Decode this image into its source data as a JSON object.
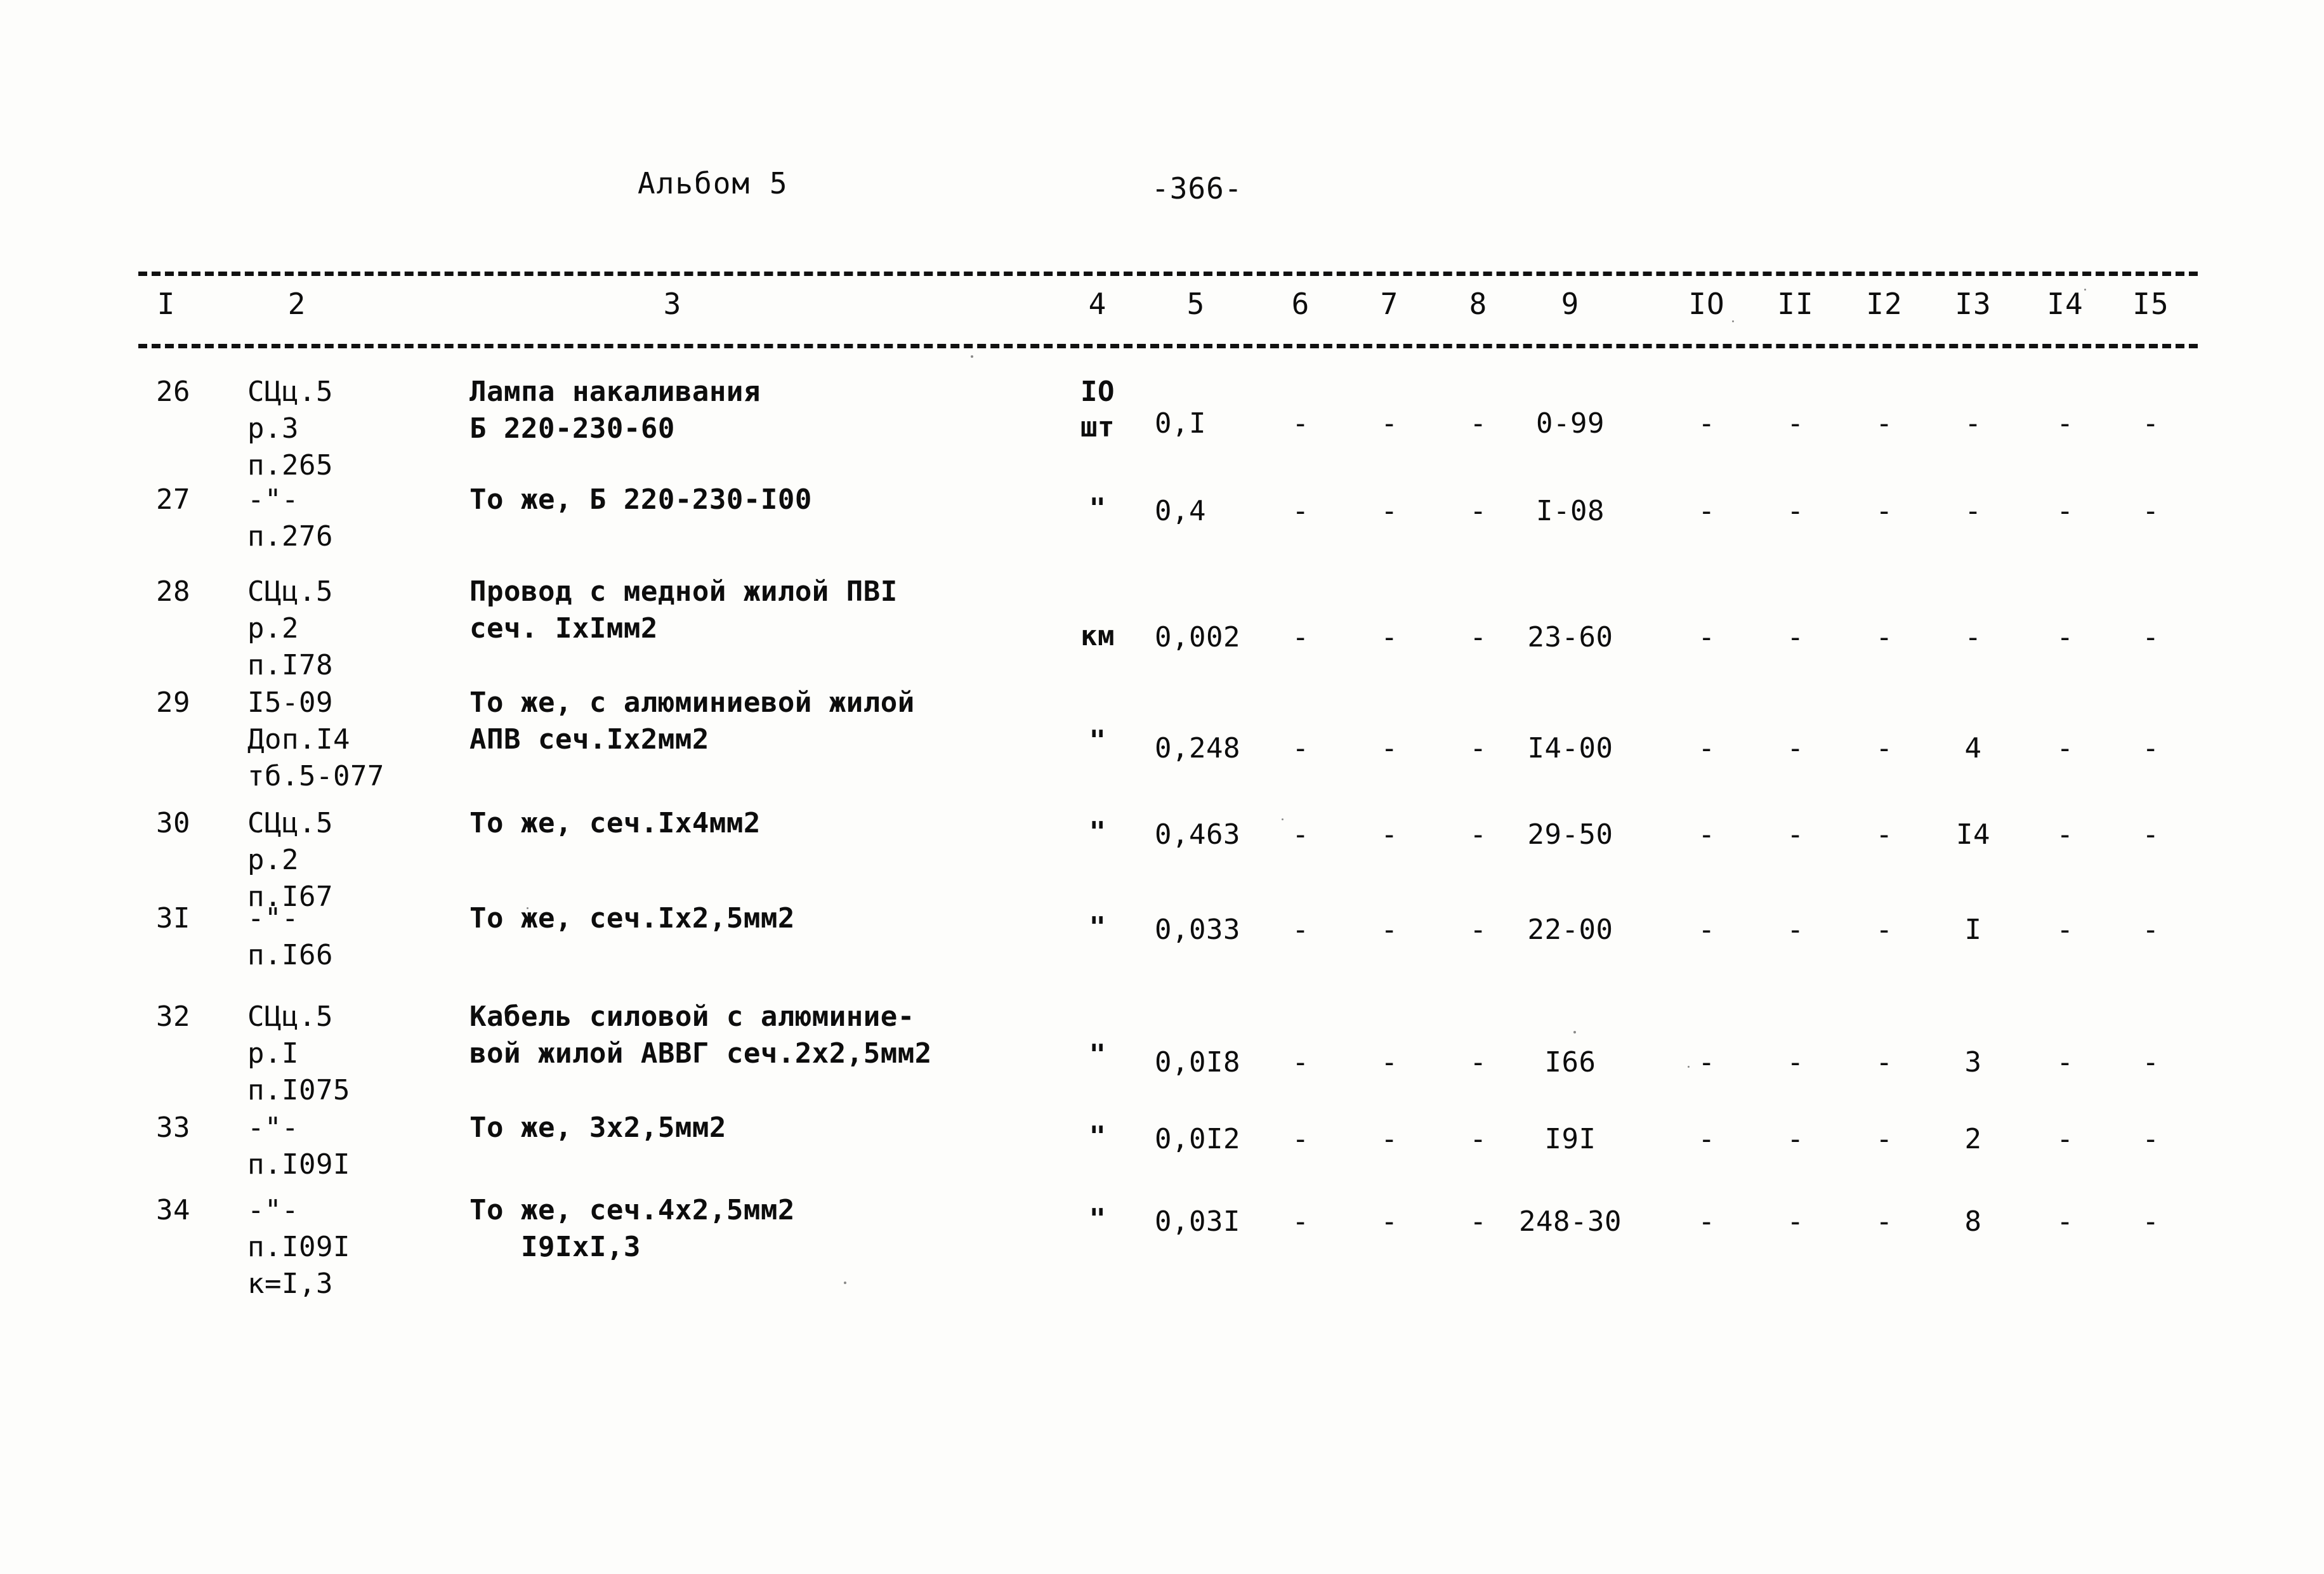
{
  "header": {
    "album_title": "Альбом 5",
    "page_number": "-366-"
  },
  "table": {
    "column_headers": [
      "I",
      "2",
      "3",
      "4",
      "5",
      "6",
      "7",
      "8",
      "9",
      "IO",
      "II",
      "I2",
      "I3",
      "I4",
      "I5"
    ],
    "rows": [
      {
        "no": "26",
        "ref_lines": [
          "СЦц.5",
          "р.3",
          "п.265"
        ],
        "desc_lines": [
          "Лампа накаливания",
          "Б 220-230-60"
        ],
        "unit_lines": [
          "IO",
          "шт"
        ],
        "qty": "0,I",
        "c6": "-",
        "c7": "-",
        "c8": "-",
        "c9": "0-99",
        "c10": "-",
        "c11": "-",
        "c12": "-",
        "c13": "-",
        "c14": "-",
        "c15": "-"
      },
      {
        "no": "27",
        "ref_lines": [
          "-\"-",
          "п.276"
        ],
        "desc_lines": [
          "То же, Б 220-230-I00"
        ],
        "unit_lines": [
          "\""
        ],
        "qty": "0,4",
        "c6": "-",
        "c7": "-",
        "c8": "-",
        "c9": "I-08",
        "c10": "-",
        "c11": "-",
        "c12": "-",
        "c13": "-",
        "c14": "-",
        "c15": "-"
      },
      {
        "no": "28",
        "ref_lines": [
          "СЦц.5",
          "р.2",
          "п.I78"
        ],
        "desc_lines": [
          "Провод с медной жилой ПВI",
          "сеч. IxIмм2"
        ],
        "unit_lines": [
          "км"
        ],
        "qty": "0,002",
        "c6": "-",
        "c7": "-",
        "c8": "-",
        "c9": "23-60",
        "c10": "-",
        "c11": "-",
        "c12": "-",
        "c13": "-",
        "c14": "-",
        "c15": "-"
      },
      {
        "no": "29",
        "ref_lines": [
          "I5-09",
          "Доп.I4",
          "тб.5-077"
        ],
        "desc_lines": [
          "То же, с алюминиевой жилой",
          "АПВ сеч.Ix2мм2"
        ],
        "unit_lines": [
          "\""
        ],
        "qty": "0,248",
        "c6": "-",
        "c7": "-",
        "c8": "-",
        "c9": "I4-00",
        "c10": "-",
        "c11": "-",
        "c12": "-",
        "c13": "4",
        "c14": "-",
        "c15": "-"
      },
      {
        "no": "30",
        "ref_lines": [
          "СЦц.5",
          "р.2",
          "п.I67"
        ],
        "desc_lines": [
          "То же, сеч.Ix4мм2"
        ],
        "unit_lines": [
          "\""
        ],
        "qty": "0,463",
        "c6": "-",
        "c7": "-",
        "c8": "-",
        "c9": "29-50",
        "c10": "-",
        "c11": "-",
        "c12": "-",
        "c13": "I4",
        "c14": "-",
        "c15": "-"
      },
      {
        "no": "3I",
        "ref_lines": [
          "-\"-",
          "п.I66"
        ],
        "desc_lines": [
          "То же, сеч.Ix2,5мм2"
        ],
        "unit_lines": [
          "\""
        ],
        "qty": "0,033",
        "c6": "-",
        "c7": "-",
        "c8": "-",
        "c9": "22-00",
        "c10": "-",
        "c11": "-",
        "c12": "-",
        "c13": "I",
        "c14": "-",
        "c15": "-"
      },
      {
        "no": "32",
        "ref_lines": [
          "СЦц.5",
          "р.I",
          "п.I075"
        ],
        "desc_lines": [
          "Кабель силовой с алюминие-",
          "вой жилой АВВГ сеч.2x2,5мм2"
        ],
        "unit_lines": [
          "\""
        ],
        "qty": "0,0I8",
        "c6": "-",
        "c7": "-",
        "c8": "-",
        "c9": "I66",
        "c10": "-",
        "c11": "-",
        "c12": "-",
        "c13": "3",
        "c14": "-",
        "c15": "-"
      },
      {
        "no": "33",
        "ref_lines": [
          "-\"-",
          "п.I09I"
        ],
        "desc_lines": [
          "То же, 3x2,5мм2"
        ],
        "unit_lines": [
          "\""
        ],
        "qty": "0,0I2",
        "c6": "-",
        "c7": "-",
        "c8": "-",
        "c9": "I9I",
        "c10": "-",
        "c11": "-",
        "c12": "-",
        "c13": "2",
        "c14": "-",
        "c15": "-"
      },
      {
        "no": "34",
        "ref_lines": [
          "-\"-",
          "п.I09I",
          "к=I,3"
        ],
        "desc_lines": [
          "То же, сеч.4x2,5мм2",
          "   I9IxI,3"
        ],
        "unit_lines": [
          "\""
        ],
        "qty": "0,03I",
        "c6": "-",
        "c7": "-",
        "c8": "-",
        "c9": "248-30",
        "c10": "-",
        "c11": "-",
        "c12": "-",
        "c13": "8",
        "c14": "-",
        "c15": "-"
      }
    ]
  }
}
